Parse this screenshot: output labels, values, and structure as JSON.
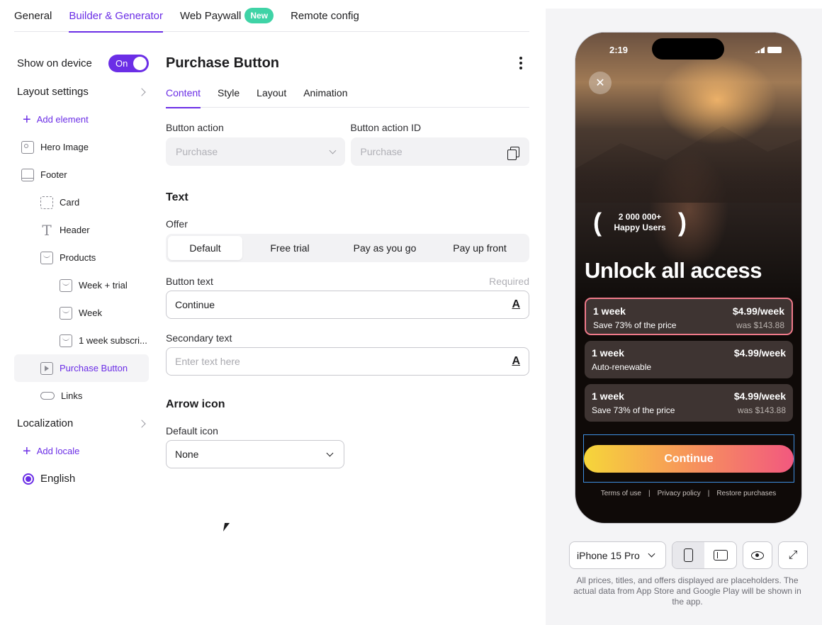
{
  "top_tabs": [
    {
      "label": "General"
    },
    {
      "label": "Builder & Generator"
    },
    {
      "label": "Web Paywall",
      "badge": "New"
    },
    {
      "label": "Remote config"
    }
  ],
  "sidebar": {
    "show_on_device": "Show on device",
    "toggle": "On",
    "layout_settings": "Layout settings",
    "add_element": "Add element",
    "items": [
      "Hero Image",
      "Footer",
      "Card",
      "Header",
      "Products",
      "Week + trial",
      "Week",
      "1 week subscri...",
      "Purchase Button",
      "Links"
    ],
    "localization": "Localization",
    "add_locale": "Add locale",
    "locale": "English"
  },
  "panel": {
    "title": "Purchase Button",
    "tabs": [
      "Content",
      "Style",
      "Layout",
      "Animation"
    ],
    "button_action_label": "Button action",
    "button_action_value": "Purchase",
    "button_action_id_label": "Button action ID",
    "button_action_id_value": "Purchase",
    "text_section": "Text",
    "offer_label": "Offer",
    "offer_options": [
      "Default",
      "Free trial",
      "Pay as you go",
      "Pay up front"
    ],
    "button_text_label": "Button text",
    "required": "Required",
    "button_text_value": "Continue",
    "text_icon": "A",
    "secondary_text_label": "Secondary text",
    "secondary_text_placeholder": "Enter text here",
    "arrow_section": "Arrow icon",
    "default_icon_label": "Default icon",
    "default_icon_value": "None"
  },
  "preview": {
    "time": "2:19",
    "close": "✕",
    "users_count": "2 000 000+",
    "users_label": "Happy Users",
    "headline": "Unlock all access",
    "plans": [
      {
        "title": "1 week",
        "price": "$4.99/week",
        "subtitle": "Save 73% of the price",
        "was": "was $143.88"
      },
      {
        "title": "1 week",
        "price": "$4.99/week",
        "subtitle": "Auto-renewable",
        "was": ""
      },
      {
        "title": "1 week",
        "price": "$4.99/week",
        "subtitle": "Save 73% of the price",
        "was": "was $143.88"
      }
    ],
    "cta": "Continue",
    "links": [
      "Terms of use",
      "Privacy policy",
      "Restore purchases"
    ],
    "device": "iPhone 15 Pro",
    "disclaimer": "All prices, titles, and offers displayed are placeholders. The actual data from App Store and Google Play will be shown in the app."
  },
  "colors": {
    "accent": "#6b2ee6",
    "new_badge": "#3fd3a6",
    "selection_frame": "#3e8fe0"
  }
}
